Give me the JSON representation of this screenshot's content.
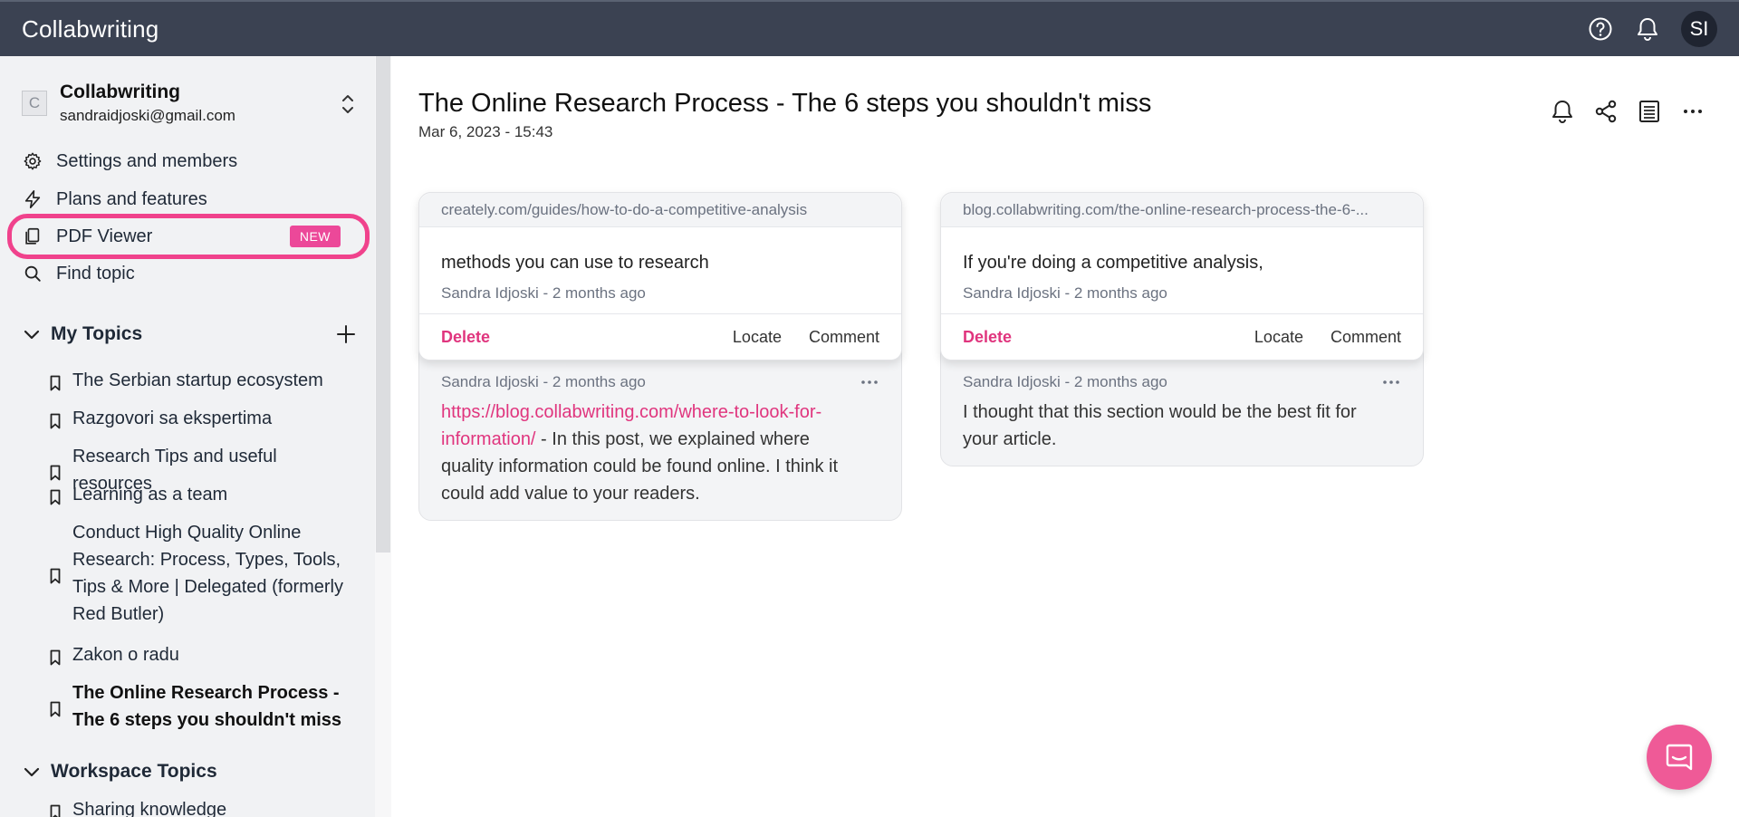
{
  "app": {
    "brand": "Collabwriting"
  },
  "header": {
    "avatar_initials": "SI",
    "icons": [
      "help-icon",
      "bell-icon"
    ]
  },
  "sidebar": {
    "workspace": {
      "logo_letter": "C",
      "name": "Collabwriting",
      "email": "sandraidjoski@gmail.com"
    },
    "nav": [
      {
        "label": "Settings and members",
        "icon": "gear-icon"
      },
      {
        "label": "Plans and features",
        "icon": "lightning-icon"
      },
      {
        "label": "PDF Viewer",
        "icon": "pdf-icon",
        "badge": "NEW",
        "highlighted": true
      },
      {
        "label": "Find topic",
        "icon": "search-icon"
      }
    ],
    "my_topics": {
      "title": "My Topics",
      "items": [
        {
          "line1": "The Serbian startup ecosystem"
        },
        {
          "line1": "Razgovori sa ekspertima"
        },
        {
          "line1": "Research Tips and useful resources"
        },
        {
          "line1": "Learning as a team"
        },
        {
          "line1": "Conduct High Quality Online",
          "line2": "Research: Process, Types, Tools,",
          "line3": "Tips & More | Delegated (formerly",
          "line4": "Red Butler)"
        },
        {
          "line1": "Zakon o radu"
        },
        {
          "line1": "The Online Research Process -",
          "line2": "The 6 steps you shouldn't miss",
          "active": true
        }
      ]
    },
    "workspace_topics": {
      "title": "Workspace Topics",
      "items": [
        {
          "line1": "Sharing knowledge"
        }
      ]
    }
  },
  "main": {
    "title": "The Online Research Process - The 6 steps you shouldn't miss",
    "date": "Mar 6, 2023 - 15:43",
    "toolbar_icons": [
      "bell-icon",
      "share-icon",
      "list-icon",
      "more-icon"
    ],
    "cards": [
      {
        "url": "creately.com/guides/how-to-do-a-competitive-analysis",
        "quote": "methods you can use to research",
        "meta": "Sandra Idjoski - 2 months ago",
        "actions": {
          "delete": "Delete",
          "locate": "Locate",
          "comment": "Comment"
        },
        "comment": {
          "meta": "Sandra Idjoski  -  2 months ago",
          "link_line1": "https://blog.collabwriting.com/where-to-look-for-",
          "link_line2": "information/",
          "text_after_link": " - In this post, we explained where",
          "text_line3": "quality information could be found online. I think it",
          "text_line4": "could add value to your readers."
        }
      },
      {
        "url": "blog.collabwriting.com/the-online-research-process-the-6-...",
        "quote": "If you're doing a competitive analysis,",
        "meta": "Sandra Idjoski - 2 months ago",
        "actions": {
          "delete": "Delete",
          "locate": "Locate",
          "comment": "Comment"
        },
        "comment": {
          "meta": "Sandra Idjoski  -  2 months ago",
          "text_line1": "I thought that this section would be the best fit for",
          "text_line2": "your article."
        }
      }
    ]
  }
}
